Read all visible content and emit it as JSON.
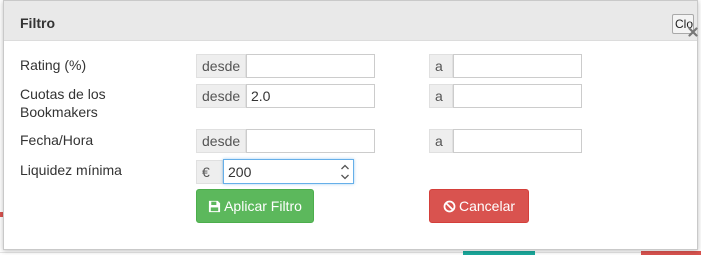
{
  "dialog": {
    "title": "Filtro",
    "close_label": "Close"
  },
  "rows": [
    {
      "label": "Rating (%)",
      "from_addon": "desde",
      "from_value": "",
      "to_addon": "a",
      "to_value": ""
    },
    {
      "label": "Cuotas de los Bookmakers",
      "from_addon": "desde",
      "from_value": "2.0",
      "to_addon": "a",
      "to_value": ""
    },
    {
      "label": "Fecha/Hora",
      "from_addon": "desde",
      "from_value": "",
      "to_addon": "a",
      "to_value": ""
    }
  ],
  "liquidity": {
    "label": "Liquidez mínima",
    "currency": "€",
    "value": "200"
  },
  "buttons": {
    "apply": "Aplicar Filtro",
    "cancel": "Cancelar"
  },
  "colors": {
    "apply": "#5cb85c",
    "cancel": "#d9534f",
    "focus": "#66afe9"
  },
  "icons": {
    "apply": "floppy-disk-icon",
    "cancel": "ban-icon",
    "close": "close-x-icon"
  }
}
